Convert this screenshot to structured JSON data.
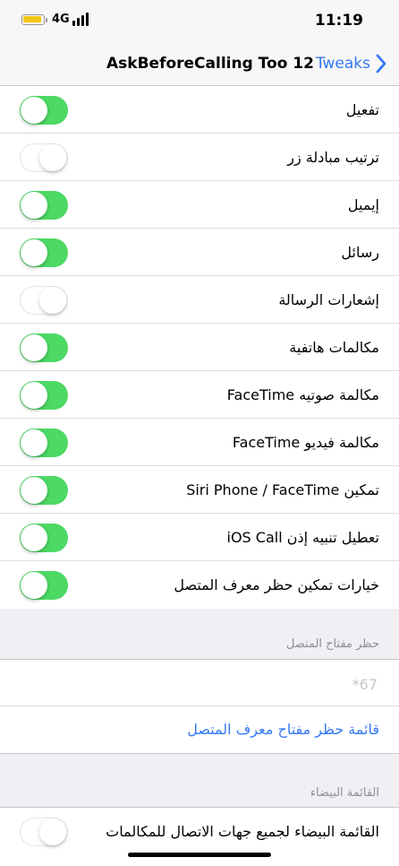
{
  "status_bar": {
    "network": "4G",
    "time": "11:19",
    "battery_color": "#f5c518"
  },
  "nav": {
    "title": "AskBeforeCalling Too 12",
    "back_label": "Tweaks",
    "back_icon": "chevron-right-icon"
  },
  "settings": [
    {
      "label": "تفعيل",
      "on": true
    },
    {
      "label": "ترتيب مبادلة زر",
      "on": false
    },
    {
      "label": "إيميل",
      "on": true
    },
    {
      "label": "رسائل",
      "on": true
    },
    {
      "label": "إشعارات الرسالة",
      "on": false
    },
    {
      "label": "مكالمات هاتفية",
      "on": true
    },
    {
      "label": "مكالمة صوتيه FaceTime",
      "on": true
    },
    {
      "label": "مكالمة فيديو FaceTime",
      "on": true
    },
    {
      "label": "تمكين Siri Phone / FaceTime",
      "on": true
    },
    {
      "label": "تعطيل تنبيه إذن iOS Call",
      "on": true
    },
    {
      "label": "خيارات تمكين حظر معرف المتصل",
      "on": true
    }
  ],
  "block_section": {
    "header": "حظر مفتاح المتصل",
    "input_value": "",
    "input_placeholder": "*67",
    "link_label": "قائمة حظر  مفتاح معرف المتصل"
  },
  "whitelist_section": {
    "header": "القائمة البيضاء",
    "row_label": "القائمة البيضاء لجميع جهات الاتصال للمكالمات",
    "on": false
  },
  "colors": {
    "accent": "#3478f6",
    "switch_on": "#4cd964",
    "background": "#efeff4"
  }
}
